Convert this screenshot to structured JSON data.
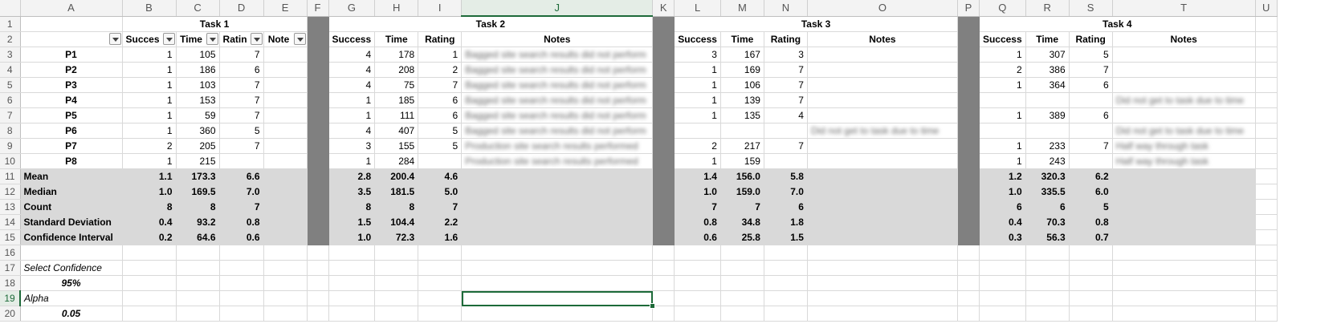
{
  "columns": [
    "A",
    "B",
    "C",
    "D",
    "E",
    "F",
    "G",
    "H",
    "I",
    "J",
    "K",
    "L",
    "M",
    "N",
    "O",
    "P",
    "Q",
    "R",
    "S",
    "T",
    "U"
  ],
  "selected_column": "J",
  "selected_row": "19",
  "rows": {
    "r1": {
      "num": "1",
      "task1": "Task 1",
      "task2": "Task 2",
      "task3": "Task 3",
      "task4": "Task 4"
    },
    "r2": {
      "num": "2",
      "t1": [
        "Succes",
        "Time",
        "Ratin",
        "Note"
      ],
      "t2": [
        "Success",
        "Time",
        "Rating",
        "Notes"
      ],
      "t3": [
        "Success",
        "Time",
        "Rating",
        "Notes"
      ],
      "t4": [
        "Success",
        "Time",
        "Rating",
        "Notes"
      ]
    },
    "participants": [
      {
        "num": "3",
        "label": "P1",
        "t1": [
          "1",
          "105",
          "7"
        ],
        "t2": [
          "4",
          "178",
          "1"
        ],
        "t2_note": "Bagged site search results did not perform",
        "t3": [
          "3",
          "167",
          "3"
        ],
        "t3_note": "",
        "t4": [
          "1",
          "307",
          "5"
        ],
        "t4_note": ""
      },
      {
        "num": "4",
        "label": "P2",
        "t1": [
          "1",
          "186",
          "6"
        ],
        "t2": [
          "4",
          "208",
          "2"
        ],
        "t2_note": "Bagged site search results did not perform",
        "t3": [
          "1",
          "169",
          "7"
        ],
        "t3_note": "",
        "t4": [
          "2",
          "386",
          "7"
        ],
        "t4_note": ""
      },
      {
        "num": "5",
        "label": "P3",
        "t1": [
          "1",
          "103",
          "7"
        ],
        "t2": [
          "4",
          "75",
          "7"
        ],
        "t2_note": "Bagged site search results did not perform",
        "t3": [
          "1",
          "106",
          "7"
        ],
        "t3_note": "",
        "t4": [
          "1",
          "364",
          "6"
        ],
        "t4_note": ""
      },
      {
        "num": "6",
        "label": "P4",
        "t1": [
          "1",
          "153",
          "7"
        ],
        "t2": [
          "1",
          "185",
          "6"
        ],
        "t2_note": "Bagged site search results did not perform",
        "t3": [
          "1",
          "139",
          "7"
        ],
        "t3_note": "",
        "t4": [
          "",
          "",
          ""
        ],
        "t4_note": "Did not get to task due to time"
      },
      {
        "num": "7",
        "label": "P5",
        "t1": [
          "1",
          "59",
          "7"
        ],
        "t2": [
          "1",
          "111",
          "6"
        ],
        "t2_note": "Bagged site search results did not perform",
        "t3": [
          "1",
          "135",
          "4"
        ],
        "t3_note": "",
        "t4": [
          "1",
          "389",
          "6"
        ],
        "t4_note": ""
      },
      {
        "num": "8",
        "label": "P6",
        "t1": [
          "1",
          "360",
          "5"
        ],
        "t2": [
          "4",
          "407",
          "5"
        ],
        "t2_note": "Bagged site search results did not perform",
        "t3": [
          "",
          "",
          ""
        ],
        "t3_note": "Did not get to task due to time",
        "t4": [
          "",
          "",
          ""
        ],
        "t4_note": "Did not get to task due to time"
      },
      {
        "num": "9",
        "label": "P7",
        "t1": [
          "2",
          "205",
          "7"
        ],
        "t2": [
          "3",
          "155",
          "5"
        ],
        "t2_note": "Production site search results performed",
        "t3": [
          "2",
          "217",
          "7"
        ],
        "t3_note": "",
        "t4": [
          "1",
          "233",
          "7"
        ],
        "t4_note": "Half way through task"
      },
      {
        "num": "10",
        "label": "P8",
        "t1": [
          "1",
          "215",
          ""
        ],
        "t2": [
          "1",
          "284",
          ""
        ],
        "t2_note": "Production site search results performed",
        "t3": [
          "1",
          "159",
          ""
        ],
        "t3_note": "",
        "t4": [
          "1",
          "243",
          ""
        ],
        "t4_note": "Half way through task"
      }
    ],
    "stats": [
      {
        "num": "11",
        "label": "Mean",
        "t1": [
          "1.1",
          "173.3",
          "6.6"
        ],
        "t2": [
          "2.8",
          "200.4",
          "4.6"
        ],
        "t3": [
          "1.4",
          "156.0",
          "5.8"
        ],
        "t4": [
          "1.2",
          "320.3",
          "6.2"
        ]
      },
      {
        "num": "12",
        "label": "Median",
        "t1": [
          "1.0",
          "169.5",
          "7.0"
        ],
        "t2": [
          "3.5",
          "181.5",
          "5.0"
        ],
        "t3": [
          "1.0",
          "159.0",
          "7.0"
        ],
        "t4": [
          "1.0",
          "335.5",
          "6.0"
        ]
      },
      {
        "num": "13",
        "label": "Count",
        "t1": [
          "8",
          "8",
          "7"
        ],
        "t2": [
          "8",
          "8",
          "7"
        ],
        "t3": [
          "7",
          "7",
          "6"
        ],
        "t4": [
          "6",
          "6",
          "5"
        ]
      },
      {
        "num": "14",
        "label": "Standard Deviation",
        "t1": [
          "0.4",
          "93.2",
          "0.8"
        ],
        "t2": [
          "1.5",
          "104.4",
          "2.2"
        ],
        "t3": [
          "0.8",
          "34.8",
          "1.8"
        ],
        "t4": [
          "0.4",
          "70.3",
          "0.8"
        ]
      },
      {
        "num": "15",
        "label": "Confidence Interval",
        "t1": [
          "0.2",
          "64.6",
          "0.6"
        ],
        "t2": [
          "1.0",
          "72.3",
          "1.6"
        ],
        "t3": [
          "0.6",
          "25.8",
          "1.5"
        ],
        "t4": [
          "0.3",
          "56.3",
          "0.7"
        ]
      }
    ],
    "r16": {
      "num": "16"
    },
    "r17": {
      "num": "17",
      "a": "Select Confidence"
    },
    "r18": {
      "num": "18",
      "a": "95%"
    },
    "r19": {
      "num": "19",
      "a": "Alpha"
    },
    "r20": {
      "num": "20",
      "a": "0.05"
    }
  },
  "colors": {
    "grid": "#d9d9d9",
    "header_bg": "#f3f3f3",
    "stat_bg": "#d9d9d9",
    "separator": "#808080",
    "selection": "#1d6a39"
  }
}
